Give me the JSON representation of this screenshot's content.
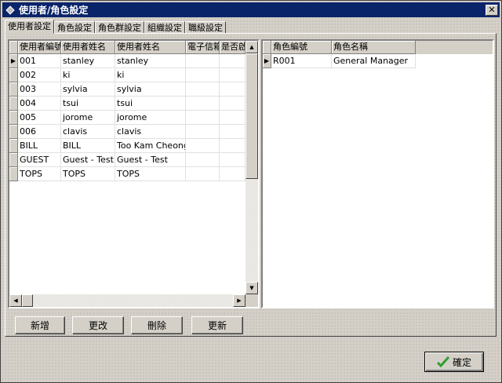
{
  "window": {
    "title": "使用者/角色設定",
    "close_label": "✕"
  },
  "tabs": [
    {
      "label": "使用者設定"
    },
    {
      "label": "角色設定"
    },
    {
      "label": "角色群設定"
    },
    {
      "label": "組織設定"
    },
    {
      "label": "職級設定"
    }
  ],
  "users_grid": {
    "columns": [
      "使用者編號",
      "使用者姓名",
      "使用者姓名",
      "電子信箱",
      "是否啟用"
    ],
    "rows": [
      [
        "001",
        "stanley",
        "stanley",
        "",
        ""
      ],
      [
        "002",
        "ki",
        "ki",
        "",
        ""
      ],
      [
        "003",
        "sylvia",
        "sylvia",
        "",
        ""
      ],
      [
        "004",
        "tsui",
        "tsui",
        "",
        ""
      ],
      [
        "005",
        "jorome",
        "jorome",
        "",
        ""
      ],
      [
        "006",
        "clavis",
        "clavis",
        "",
        ""
      ],
      [
        "BILL",
        "BILL",
        "Too Kam Cheong",
        "",
        ""
      ],
      [
        "GUEST",
        "Guest - Test",
        "Guest - Test",
        "",
        ""
      ],
      [
        "TOPS",
        "TOPS",
        "TOPS",
        "",
        ""
      ]
    ]
  },
  "roles_grid": {
    "columns": [
      "角色編號",
      "角色名稱"
    ],
    "rows": [
      [
        "R001",
        "General Manager"
      ]
    ]
  },
  "buttons": {
    "add": "新增",
    "edit": "更改",
    "delete": "刪除",
    "update": "更新",
    "ok": "確定"
  },
  "colors": {
    "titlebar": "#0a246a",
    "ok_check": "#2e9e2e"
  }
}
